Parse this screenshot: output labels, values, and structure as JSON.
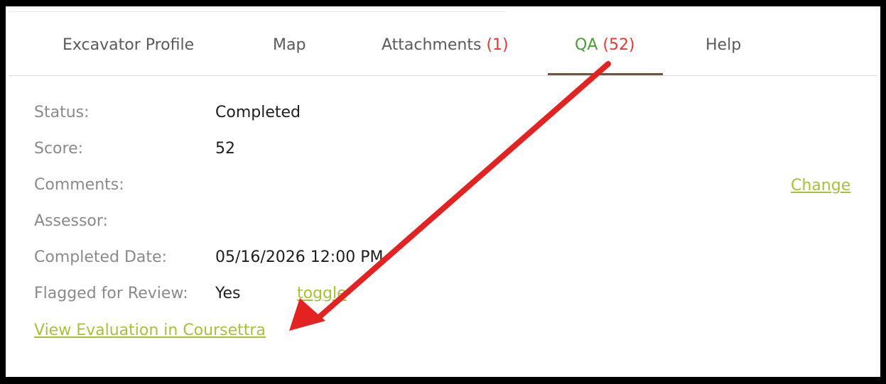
{
  "tabs": [
    {
      "label": "Excavator Profile",
      "count": ""
    },
    {
      "label": "Map",
      "count": ""
    },
    {
      "label": "Attachments ",
      "count": "(1)"
    },
    {
      "label": "QA ",
      "count": "(52)"
    },
    {
      "label": "Help",
      "count": ""
    }
  ],
  "active_tab": "QA",
  "details": {
    "status": {
      "label": "Status:",
      "value": "Completed"
    },
    "score": {
      "label": "Score:",
      "value": "52"
    },
    "comments": {
      "label": "Comments:",
      "value": ""
    },
    "assessor": {
      "label": "Assessor:",
      "value": ""
    },
    "completed_date": {
      "label": "Completed Date:",
      "value": "05/16/2026 12:00 PM"
    },
    "flagged": {
      "label": "Flagged for Review:",
      "value": "Yes"
    }
  },
  "links": {
    "change": "Change",
    "toggle": "toggle",
    "view_evaluation": "View Evaluation in Coursettra"
  },
  "colors": {
    "link": "#a6c23a",
    "count": "#e53935",
    "active_tab": "#4d9a3a",
    "tab_underline": "#6f5441",
    "annotation_arrow": "#e32222"
  }
}
